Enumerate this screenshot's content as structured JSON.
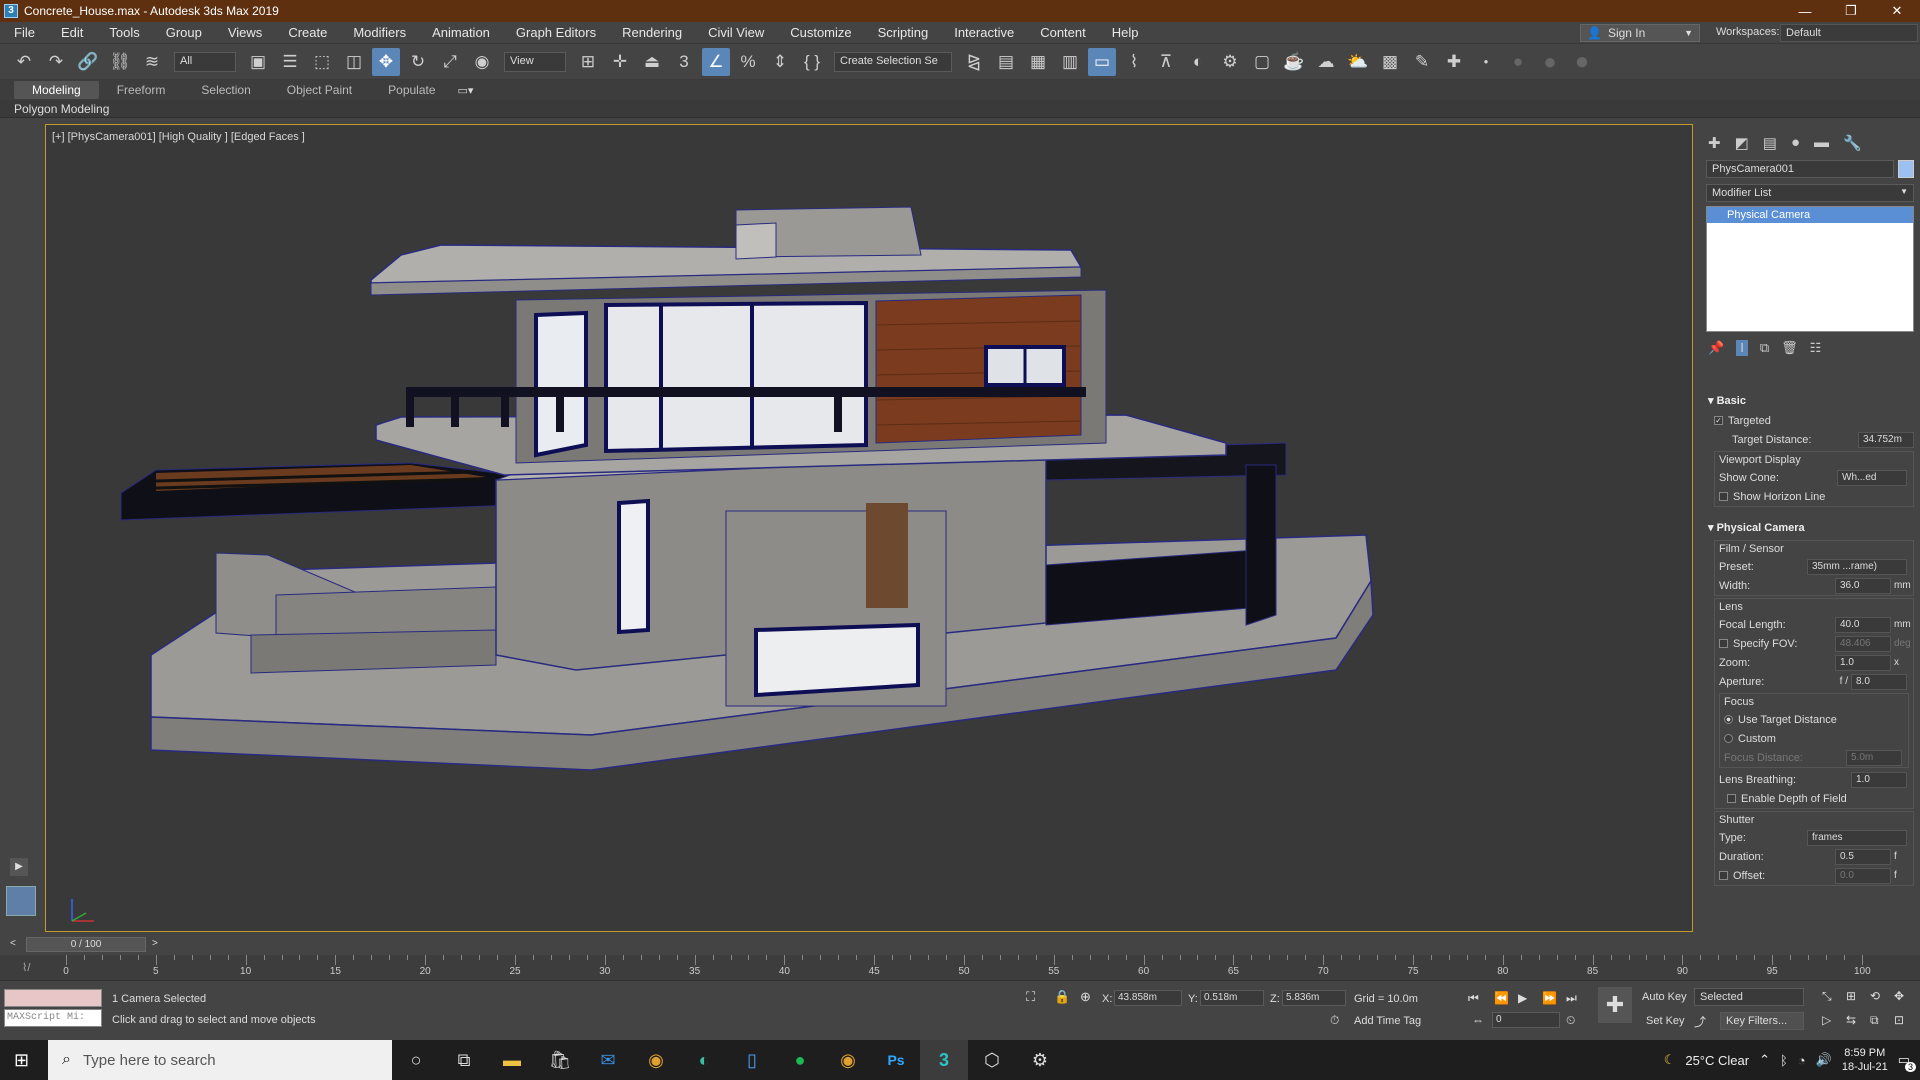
{
  "window": {
    "title": "Concrete_House.max - Autodesk 3ds Max 2019",
    "app_icon": "3",
    "minimize": "—",
    "restore": "❐",
    "close": "✕"
  },
  "menu": [
    "File",
    "Edit",
    "Tools",
    "Group",
    "Views",
    "Create",
    "Modifiers",
    "Animation",
    "Graph Editors",
    "Rendering",
    "Civil View",
    "Customize",
    "Scripting",
    "Interactive",
    "Content",
    "Help"
  ],
  "account": {
    "sign_in": "Sign In",
    "workspaces_label": "Workspaces:",
    "workspace": "Default"
  },
  "toolbar": {
    "filter": "All",
    "ref_coord": "View",
    "selection_set": "Create Selection Se"
  },
  "ribbon": {
    "tabs": [
      "Modeling",
      "Freeform",
      "Selection",
      "Object Paint",
      "Populate"
    ],
    "active": "Modeling",
    "panel": "Polygon Modeling"
  },
  "viewport": {
    "label": "[+] [PhysCamera001] [High Quality ] [Edged Faces ]"
  },
  "command_panel": {
    "object_name": "PhysCamera001",
    "modifier_list": "Modifier List",
    "stack_item": "Physical Camera",
    "basic": {
      "title": "Basic",
      "targeted": "Targeted",
      "target_distance_label": "Target Distance:",
      "target_distance": "34.752m",
      "viewport_display": "Viewport Display",
      "show_cone_label": "Show Cone:",
      "show_cone": "Wh...ed",
      "show_horizon": "Show Horizon Line"
    },
    "physical": {
      "title": "Physical Camera",
      "film_sensor": "Film / Sensor",
      "preset_label": "Preset:",
      "preset": "35mm ...rame)",
      "width_label": "Width:",
      "width": "36.0",
      "width_unit": "mm",
      "lens": "Lens",
      "focal_label": "Focal Length:",
      "focal": "40.0",
      "focal_unit": "mm",
      "fov_label": "Specify FOV:",
      "fov": "48.406",
      "fov_unit": "deg",
      "zoom_label": "Zoom:",
      "zoom": "1.0",
      "zoom_unit": "x",
      "aperture_label": "Aperture:",
      "aperture_prefix": "f /",
      "aperture": "8.0",
      "focus": "Focus",
      "use_target": "Use Target Distance",
      "custom": "Custom",
      "focus_distance_label": "Focus Distance:",
      "focus_distance": "5.0m",
      "lens_breathing_label": "Lens Breathing:",
      "lens_breathing": "1.0",
      "dof": "Enable Depth of Field",
      "shutter": "Shutter",
      "type_label": "Type:",
      "type": "frames",
      "duration_label": "Duration:",
      "duration": "0.5",
      "duration_unit": "f",
      "offset_label": "Offset:",
      "offset": "0.0",
      "offset_unit": "f"
    }
  },
  "timeline": {
    "frame": "0 / 100",
    "ticks": [
      "0",
      "5",
      "10",
      "15",
      "20",
      "25",
      "30",
      "35",
      "40",
      "45",
      "50",
      "55",
      "60",
      "65",
      "70",
      "75",
      "80",
      "85",
      "90",
      "95",
      "100"
    ]
  },
  "status": {
    "maxscript": "MAXScript Mi:",
    "selection": "1 Camera Selected",
    "prompt": "Click and drag to select and move objects",
    "x_label": "X:",
    "x": "43.858m",
    "y_label": "Y:",
    "y": "0.518m",
    "z_label": "Z:",
    "z": "5.836m",
    "grid": "Grid = 10.0m",
    "add_time_tag": "Add Time Tag",
    "auto_key": "Auto Key",
    "selected": "Selected",
    "set_key": "Set Key",
    "key_filters": "Key Filters...",
    "frame_field": "0"
  },
  "taskbar": {
    "search_placeholder": "Type here to search",
    "weather": "25°C  Clear",
    "time": "8:59 PM",
    "date": "18-Jul-21",
    "notif_count": "3",
    "apps": [
      "cortana-icon",
      "task-view-icon",
      "file-explorer-icon",
      "store-icon",
      "mail-icon",
      "chrome-icon",
      "edge-icon",
      "phone-icon",
      "spotify-icon",
      "chrome-alt-icon",
      "photoshop-icon",
      "3dsmax-icon",
      "box-icon",
      "settings-icon"
    ]
  }
}
